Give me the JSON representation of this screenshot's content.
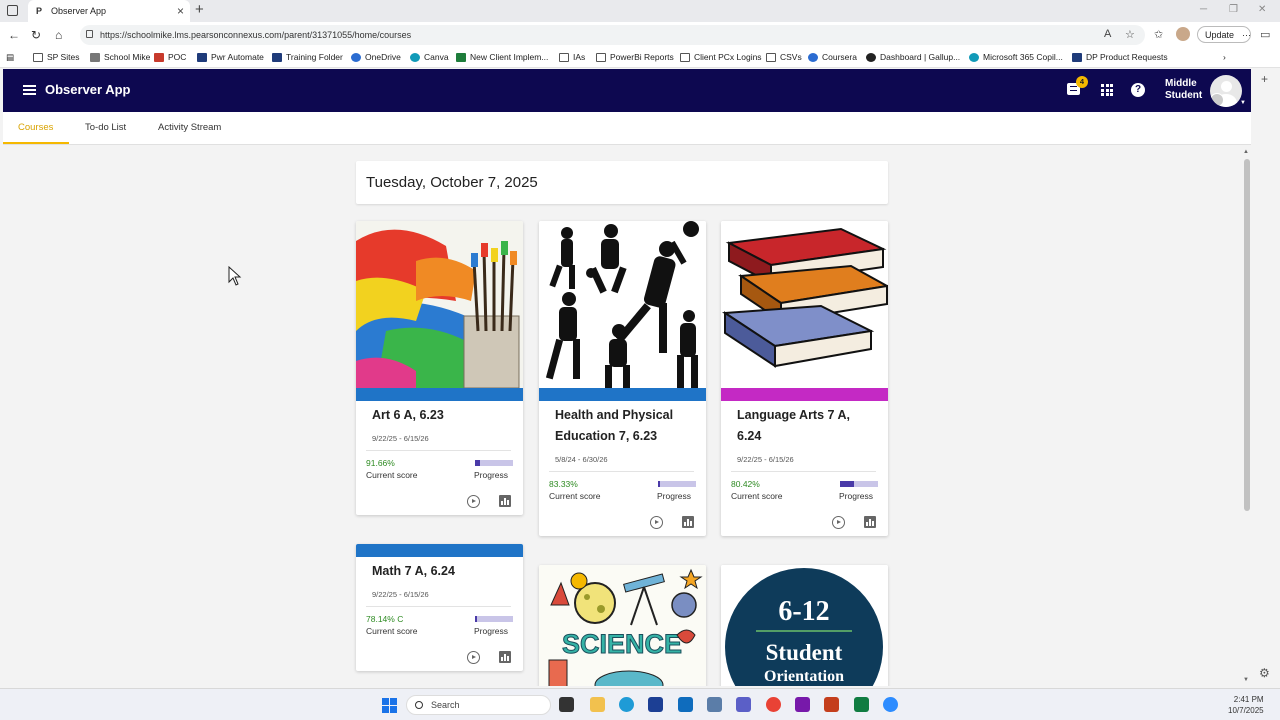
{
  "browser": {
    "tab_title": "Observer App",
    "tab_favicon": "P",
    "url": "https://schoolmike.lms.pearsonconnexus.com/parent/31371055/home/courses",
    "update_label": "Update",
    "favorites": [
      {
        "label": "SP Sites",
        "icon": "folder"
      },
      {
        "label": "School Mike",
        "icon": "grey"
      },
      {
        "label": "POC",
        "icon": "red"
      },
      {
        "label": "Pwr Automate",
        "icon": "navy"
      },
      {
        "label": "Training Folder",
        "icon": "navy"
      },
      {
        "label": "OneDrive",
        "icon": "blue"
      },
      {
        "label": "Canva",
        "icon": "teal"
      },
      {
        "label": "New Client Implem...",
        "icon": "green"
      },
      {
        "label": "IAs",
        "icon": "folder"
      },
      {
        "label": "PowerBi Reports",
        "icon": "folder"
      },
      {
        "label": "Client PCx Logins",
        "icon": "folder"
      },
      {
        "label": "CSVs",
        "icon": "folder"
      },
      {
        "label": "Coursera",
        "icon": "blue"
      },
      {
        "label": "Dashboard | Gallup...",
        "icon": "dark"
      },
      {
        "label": "Microsoft 365 Copil...",
        "icon": "teal"
      },
      {
        "label": "DP Product Requests",
        "icon": "navy"
      }
    ]
  },
  "app": {
    "title": "Observer App",
    "notification_count": "4",
    "user_line1": "Middle",
    "user_line2": "Student",
    "tabs": [
      {
        "label": "Courses",
        "active": true
      },
      {
        "label": "To-do List",
        "active": false
      },
      {
        "label": "Activity Stream",
        "active": false
      }
    ],
    "date": "Tuesday, October 7, 2025"
  },
  "courses": [
    {
      "name": "Art 6 A, 6.23",
      "dates": "9/22/25 - 6/15/26",
      "score": "91.66%",
      "score_label": "Current score",
      "progress_label": "Progress",
      "progress": 0.12,
      "stripe": "#1f74c7",
      "image": "paint"
    },
    {
      "name": "Health and Physical Education 7, 6.23",
      "dates": "5/8/24 - 6/30/26",
      "score": "83.33%",
      "score_label": "Current score",
      "progress_label": "Progress",
      "progress": 0.04,
      "stripe": "#1f74c7",
      "image": "sports"
    },
    {
      "name": "Language Arts 7 A, 6.24",
      "dates": "9/22/25 - 6/15/26",
      "score": "80.42%",
      "score_label": "Current score",
      "progress_label": "Progress",
      "progress": 0.36,
      "stripe": "#c429c4",
      "image": "books"
    },
    {
      "name": "Math 7 A, 6.24",
      "dates": "9/22/25 - 6/15/26",
      "score": "78.14% C",
      "score_label": "Current score",
      "progress_label": "Progress",
      "progress": 0.06,
      "stripe": "#1f74c7",
      "image": ""
    }
  ],
  "science_card": {
    "title": "SCIENCE"
  },
  "orientation_card": {
    "line1": "6-12",
    "line2": "Student",
    "line3": "Orientation"
  },
  "taskbar": {
    "search_placeholder": "Search",
    "time": "2:41 PM",
    "date": "10/7/2025"
  }
}
